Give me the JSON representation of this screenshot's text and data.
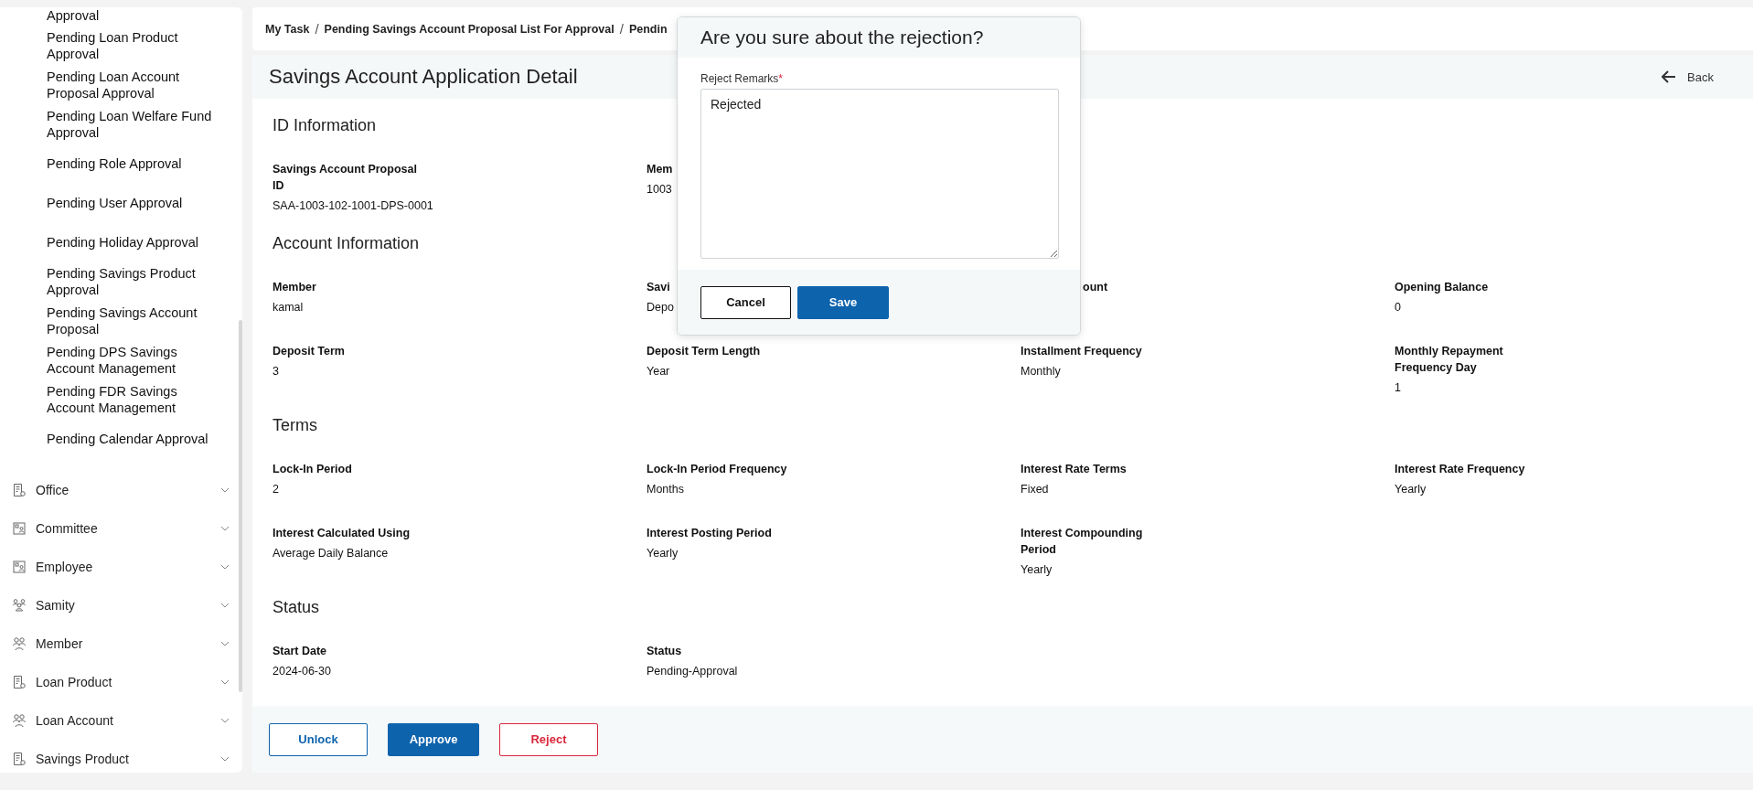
{
  "sidebar": {
    "sub_items": [
      {
        "label": "Approval"
      },
      {
        "label": "Pending Loan Product Approval"
      },
      {
        "label": "Pending Loan Account Proposal Approval"
      },
      {
        "label": "Pending Loan Welfare Fund Approval"
      },
      {
        "label": "Pending Role Approval"
      },
      {
        "label": "Pending User Approval"
      },
      {
        "label": "Pending Holiday Approval"
      },
      {
        "label": "Pending Savings Product Approval"
      },
      {
        "label": "Pending Savings Account Proposal"
      },
      {
        "label": "Pending DPS Savings Account Management"
      },
      {
        "label": "Pending FDR Savings Account Management"
      },
      {
        "label": "Pending Calendar Approval"
      }
    ],
    "menu": [
      {
        "label": "Office",
        "kind": "document",
        "expanded": false
      },
      {
        "label": "Committee",
        "kind": "card",
        "expanded": false
      },
      {
        "label": "Employee",
        "kind": "card",
        "expanded": false
      },
      {
        "label": "Samity",
        "kind": "team",
        "expanded": false
      },
      {
        "label": "Member",
        "kind": "people",
        "expanded": false
      },
      {
        "label": "Loan Product",
        "kind": "document",
        "expanded": false
      },
      {
        "label": "Loan Account",
        "kind": "people",
        "expanded": false
      },
      {
        "label": "Savings Product",
        "kind": "document",
        "expanded": false
      }
    ]
  },
  "breadcrumb": {
    "separator": "/",
    "items": [
      "My Task",
      "Pending Savings Account Proposal List For Approval",
      "Pendin"
    ]
  },
  "page": {
    "title": "Savings Account Application Detail",
    "back": "Back"
  },
  "sections": [
    {
      "heading": "ID Information",
      "fields": [
        {
          "label": "Savings Account Proposal ID",
          "value": "SAA-1003-102-1001-DPS-0001"
        },
        {
          "label": "Mem",
          "value": "1003"
        }
      ]
    },
    {
      "heading": "Account Information",
      "fields": [
        {
          "label": "Member",
          "value": "kamal"
        },
        {
          "label": "Savi",
          "value": "Depo"
        },
        {
          "label": "ount",
          "kind": "cut"
        },
        {
          "label": "Opening Balance",
          "value": "0"
        },
        {
          "label": "Deposit Term",
          "value": "3"
        },
        {
          "label": "Deposit Term Length",
          "value": "Year"
        },
        {
          "label": "Installment Frequency",
          "value": "Monthly"
        },
        {
          "label": "Monthly Repayment Frequency Day",
          "value": "1"
        }
      ]
    },
    {
      "heading": "Terms",
      "fields": [
        {
          "label": "Lock-In Period",
          "value": "2"
        },
        {
          "label": "Lock-In Period Frequency",
          "value": "Months"
        },
        {
          "label": "Interest Rate Terms",
          "value": "Fixed"
        },
        {
          "label": "Interest Rate Frequency",
          "value": "Yearly"
        },
        {
          "label": "Interest Calculated Using",
          "value": "Average Daily Balance"
        },
        {
          "label": "Interest Posting Period",
          "value": "Yearly"
        },
        {
          "label": "Interest Compounding Period",
          "value": "Yearly"
        }
      ]
    },
    {
      "heading": "Status",
      "fields": [
        {
          "label": "Start Date",
          "value": "2024-06-30"
        },
        {
          "label": "Status",
          "value": "Pending-Approval"
        }
      ]
    }
  ],
  "actions": [
    {
      "label": "Unlock",
      "kind": "outline"
    },
    {
      "label": "Approve",
      "kind": "primary"
    },
    {
      "label": "Reject",
      "kind": "danger"
    }
  ],
  "modal": {
    "title": "Are you sure about the rejection?",
    "field_label": "Reject Remarks",
    "required_mark": "*",
    "value": "Rejected",
    "buttons": [
      {
        "label": "Cancel",
        "kind": "secondary"
      },
      {
        "label": "Save",
        "kind": "primary"
      }
    ]
  }
}
